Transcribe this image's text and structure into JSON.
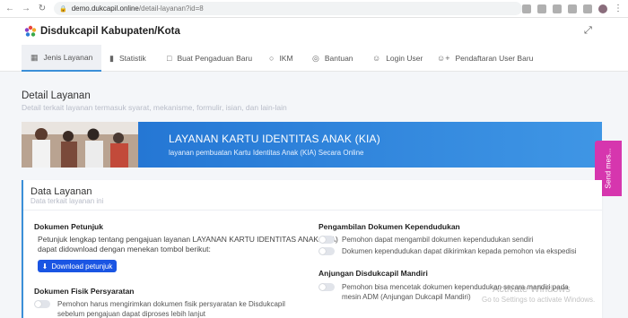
{
  "browser": {
    "url_host": "demo.dukcapil.online",
    "url_path": "/detail-layanan?id=8"
  },
  "header": {
    "brand": "Disdukcapil Kabupaten/Kota"
  },
  "tabs": [
    {
      "label": "Jenis Layanan",
      "icon": "grid-icon"
    },
    {
      "label": "Statistik",
      "icon": "bar-chart-icon"
    },
    {
      "label": "Buat Pengaduan Baru",
      "icon": "chat-icon"
    },
    {
      "label": "IKM",
      "icon": "award-icon"
    },
    {
      "label": "Bantuan",
      "icon": "help-icon"
    },
    {
      "label": "Login User",
      "icon": "user-icon"
    },
    {
      "label": "Pendaftaran User Baru",
      "icon": "user-plus-icon"
    }
  ],
  "page": {
    "title": "Detail Layanan",
    "subtitle": "Detail terkait layanan termasuk syarat, mekanisme, formulir, isian, dan lain-lain"
  },
  "banner": {
    "title": "LAYANAN KARTU IDENTITAS ANAK (KIA)",
    "subtitle": "layanan pembuatan Kartu Identitas Anak (KIA) Secara Online"
  },
  "send_tab": {
    "label": "Send mes..."
  },
  "card": {
    "title": "Data Layanan",
    "subtitle": "Data terkait layanan ini",
    "left": {
      "petunjuk_head": "Dokumen Petunjuk",
      "petunjuk_line1": "Petunjuk lengkap tentang pengajuan layanan LAYANAN KARTU IDENTITAS ANAK (KIA)",
      "petunjuk_line2": "dapat didownload dengan menekan tombol berikut:",
      "download_label": "Download petunjuk",
      "fisik_head": "Dokumen Fisik Persyaratan",
      "fisik_line1": "Pemohon harus mengirimkan dokumen fisik persyaratan ke Disdukcapil",
      "fisik_line2": "sebelum pengajuan dapat diproses lebih lanjut"
    },
    "right": {
      "pengambilan_head": "Pengambilan Dokumen Kependudukan",
      "opt1": "Pemohon dapat mengambil dokumen kependudukan sendiri",
      "opt2": "Dokumen kependudukan dapat dikirimkan kepada pemohon via ekspedisi",
      "anjungan_head": "Anjungan Disdukcapil Mandiri",
      "anjungan_line1": "Pemohon bisa mencetak dokumen kependudukan secara mandiri pada",
      "anjungan_line2": "mesin ADM (Anjungan Dukcapil Mandiri)"
    }
  },
  "watermark": {
    "line1": "Activate Windows",
    "line2": "Go to Settings to activate Windows."
  },
  "colors": {
    "accent": "#3b8fd8",
    "banner": "#2a80dd",
    "button": "#1a55e3",
    "send_tab": "#d636ae"
  }
}
